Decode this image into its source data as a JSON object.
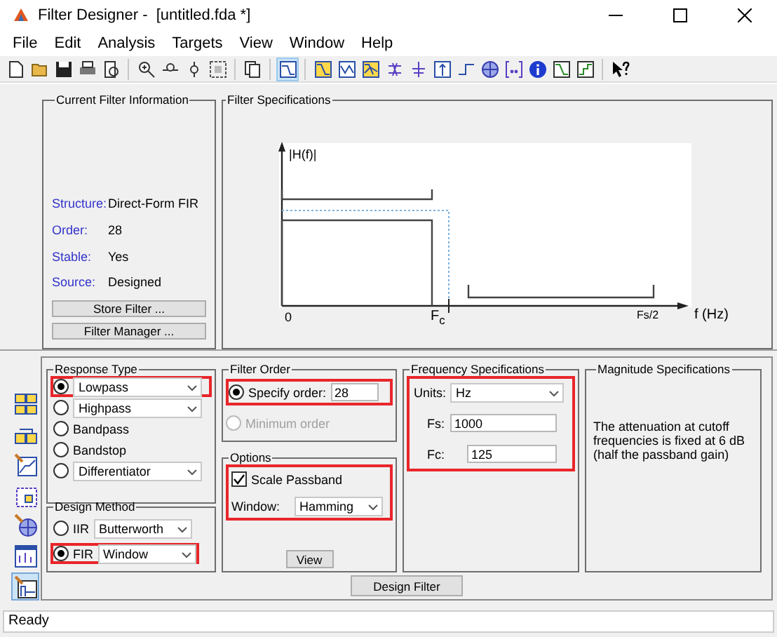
{
  "window": {
    "title": "Filter Designer -  [untitled.fda *]"
  },
  "menu": [
    "File",
    "Edit",
    "Analysis",
    "Targets",
    "View",
    "Window",
    "Help"
  ],
  "toolbar": [
    {
      "selected": false
    },
    {
      "selected": false
    },
    {
      "selected": false
    },
    {
      "selected": false
    },
    {
      "selected": false
    },
    {
      "selected": false
    },
    {
      "selected": false
    },
    {
      "selected": false
    },
    {
      "selected": false
    },
    {
      "selected": false
    },
    {
      "selected": true
    },
    {
      "selected": false
    },
    {
      "selected": false
    },
    {
      "selected": false
    },
    {
      "selected": false
    },
    {
      "selected": false
    },
    {
      "selected": false
    },
    {
      "selected": false
    },
    {
      "selected": false
    },
    {
      "selected": false
    },
    {
      "selected": false
    },
    {
      "selected": false
    },
    {
      "selected": false
    },
    {
      "selected": false
    }
  ],
  "current_filter_info": {
    "title": "Current Filter Information",
    "fields": [
      {
        "label": "Structure:",
        "value": "Direct-Form FIR"
      },
      {
        "label": "Order:",
        "value": "28"
      },
      {
        "label": "Stable:",
        "value": "Yes"
      },
      {
        "label": "Source:",
        "value": "Designed"
      }
    ],
    "buttons": [
      "Store Filter ...",
      "Filter Manager ..."
    ]
  },
  "filter_specifications": {
    "title": "Filter Specifications",
    "y_label": "|H(f)|",
    "origin_label": "0",
    "cutoff_label": "F$_{c}$",
    "nyquist_label": "Fs/2",
    "x_label": "f (Hz)"
  },
  "sidebar": [
    {
      "selected": false
    },
    {
      "selected": false
    },
    {
      "selected": false
    },
    {
      "selected": false
    },
    {
      "selected": false
    },
    {
      "selected": false
    },
    {
      "selected": true
    }
  ],
  "response_type": {
    "title": "Response Type",
    "options": [
      {
        "kind": "dropdown",
        "label": "Lowpass",
        "selected": true,
        "highlighted": true
      },
      {
        "kind": "dropdown",
        "label": "Highpass",
        "selected": false,
        "highlighted": false
      },
      {
        "kind": "plain",
        "label": "Bandpass",
        "selected": false,
        "highlighted": false
      },
      {
        "kind": "plain",
        "label": "Bandstop",
        "selected": false,
        "highlighted": false
      },
      {
        "kind": "dropdown",
        "label": "Differentiator",
        "selected": false,
        "highlighted": false
      }
    ]
  },
  "design_method": {
    "title": "Design Method",
    "options": [
      {
        "label": "IIR",
        "value": "Butterworth",
        "selected": false,
        "highlighted": false
      },
      {
        "label": "FIR",
        "value": "Window",
        "selected": true,
        "highlighted": true
      }
    ]
  },
  "filter_order": {
    "title": "Filter Order",
    "highlighted": true,
    "options": [
      {
        "label": "Specify order:",
        "value": "28",
        "selected": true,
        "disabled": false
      },
      {
        "label": "Minimum order",
        "selected": false,
        "disabled": true
      }
    ]
  },
  "options": {
    "title": "Options",
    "highlighted": true,
    "scale_passband": {
      "label": "Scale Passband",
      "checked": true
    },
    "window": {
      "label": "Window:",
      "value": "Hamming"
    },
    "button": "View"
  },
  "frequency_specifications": {
    "title": "Frequency Specifications",
    "highlighted": true,
    "units": {
      "label": "Units:",
      "value": "Hz"
    },
    "fields": [
      {
        "label": "Fs:",
        "value": "1000"
      },
      {
        "label": "Fc:",
        "value": "125"
      }
    ]
  },
  "magnitude_specifications": {
    "title": "Magnitude Specifications",
    "text": "The attenuation at cutoff frequencies is fixed at 6 dB (half the passband gain)"
  },
  "design_button": "Design Filter",
  "status_bar": "Ready"
}
